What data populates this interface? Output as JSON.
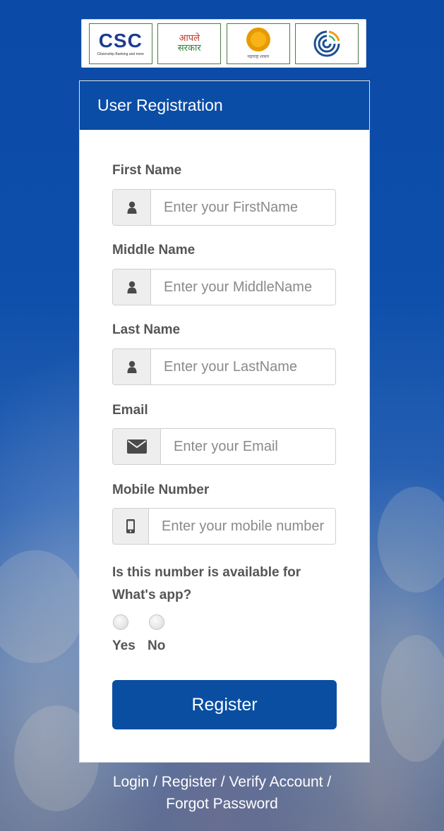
{
  "logos": {
    "csc": {
      "text": "CSC",
      "subtext": "Citizenship Banking and more"
    },
    "aaple": {
      "line1": "आपले",
      "line2": "सरकार"
    },
    "seal": {
      "subtext": "महाराष्ट्र शासन"
    },
    "egov": {
      "icon": "egov-icon"
    }
  },
  "form": {
    "title": "User Registration",
    "first_name": {
      "label": "First Name",
      "placeholder": "Enter your FirstName",
      "icon": "user-icon"
    },
    "middle_name": {
      "label": "Middle Name",
      "placeholder": "Enter your MiddleName",
      "icon": "user-icon"
    },
    "last_name": {
      "label": "Last Name",
      "placeholder": "Enter your LastName",
      "icon": "user-icon"
    },
    "email": {
      "label": "Email",
      "placeholder": "Enter your Email",
      "icon": "envelope-icon"
    },
    "mobile": {
      "label": "Mobile Number",
      "placeholder": "Enter your mobile number",
      "icon": "mobile-icon"
    },
    "whatsapp": {
      "question_line1": "Is this number is available for",
      "question_line2": "What's app?",
      "yes_label": "Yes",
      "no_label": "No"
    },
    "register_label": "Register"
  },
  "footer": {
    "login": "Login",
    "register": "Register",
    "verify": "Verify Account",
    "forgot": "Forgot Password",
    "separator": " / "
  },
  "colors": {
    "primary": "#0a4da6",
    "label": "#555555",
    "addon_bg": "#eeeeee"
  }
}
